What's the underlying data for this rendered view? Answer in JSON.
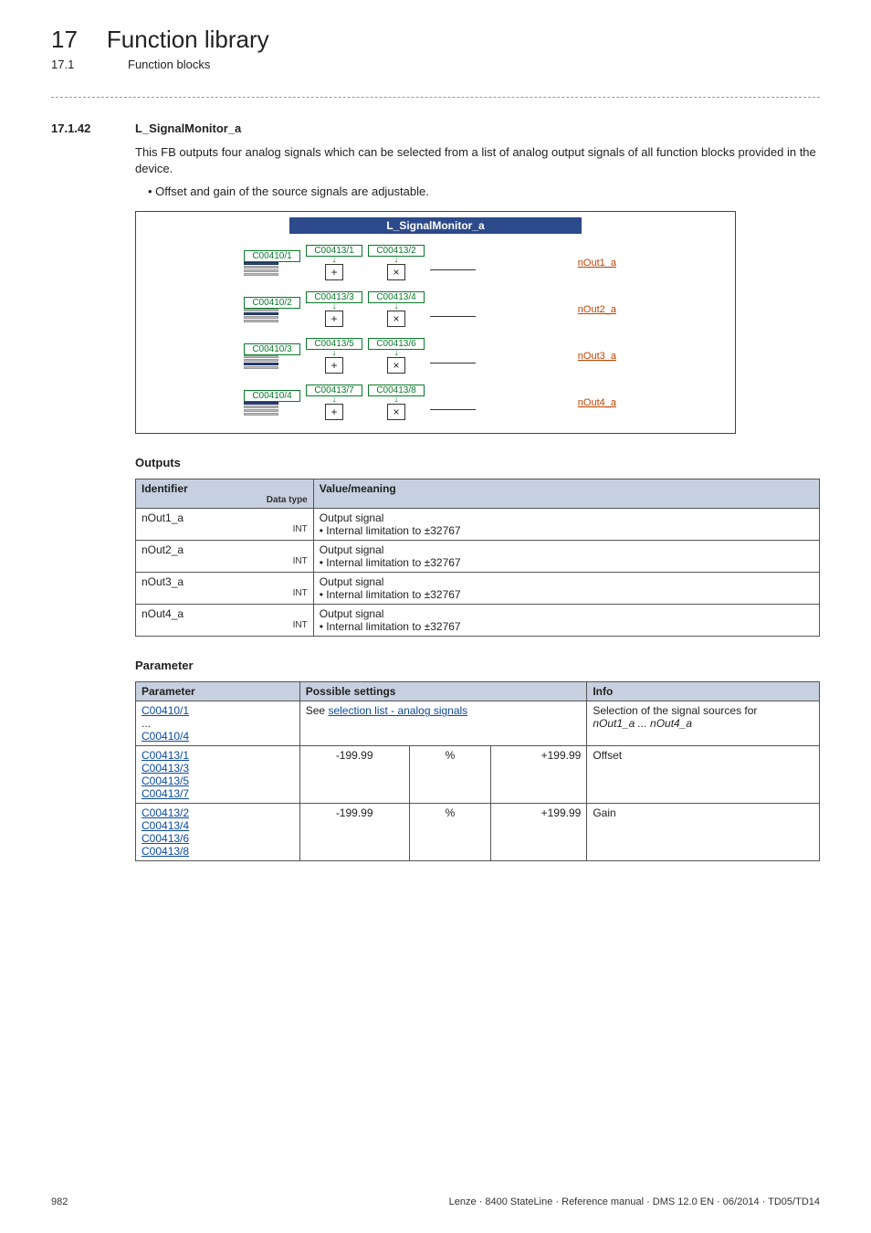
{
  "header": {
    "chapter_num": "17",
    "chapter_title": "Function library",
    "sub_num": "17.1",
    "sub_title": "Function blocks"
  },
  "section": {
    "num": "17.1.42",
    "title": "L_SignalMonitor_a",
    "lead": "This FB outputs four analog signals which can be selected from a list of analog output signals of all function blocks provided in the device.",
    "bullet1": "Offset and gain of the source signals are adjustable."
  },
  "diagram": {
    "title": "L_SignalMonitor_a",
    "rows": [
      {
        "c1": "C00410/1",
        "c2": "C00413/1",
        "c3": "C00413/2",
        "out": "nOut1_a"
      },
      {
        "c1": "C00410/2",
        "c2": "C00413/3",
        "c3": "C00413/4",
        "out": "nOut2_a"
      },
      {
        "c1": "C00410/3",
        "c2": "C00413/5",
        "c3": "C00413/6",
        "out": "nOut3_a"
      },
      {
        "c1": "C00410/4",
        "c2": "C00413/7",
        "c3": "C00413/8",
        "out": "nOut4_a"
      }
    ]
  },
  "outputs": {
    "heading": "Outputs",
    "head_id": "Identifier",
    "head_dt": "Data type",
    "head_val": "Value/meaning",
    "rows": [
      {
        "id": "nOut1_a",
        "dt": "INT",
        "l1": "Output signal",
        "l2": "• Internal limitation to ±32767"
      },
      {
        "id": "nOut2_a",
        "dt": "INT",
        "l1": "Output signal",
        "l2": "• Internal limitation to ±32767"
      },
      {
        "id": "nOut3_a",
        "dt": "INT",
        "l1": "Output signal",
        "l2": "• Internal limitation to ±32767"
      },
      {
        "id": "nOut4_a",
        "dt": "INT",
        "l1": "Output signal",
        "l2": "• Internal limitation to ±32767"
      }
    ]
  },
  "params": {
    "heading": "Parameter",
    "head_param": "Parameter",
    "head_poss": "Possible settings",
    "head_info": "Info",
    "row1": {
      "p1": "C00410/1",
      "dots": "...",
      "p2": "C00410/4",
      "see": "See ",
      "link": "selection list - analog signals",
      "info1": "Selection of the signal sources for",
      "info2": "nOut1_a ... nOut4_a"
    },
    "row2": {
      "p1": "C00413/1",
      "p2": "C00413/3",
      "p3": "C00413/5",
      "p4": "C00413/7",
      "lo": "-199.99",
      "unit": "%",
      "hi": "+199.99",
      "info": "Offset"
    },
    "row3": {
      "p1": "C00413/2",
      "p2": "C00413/4",
      "p3": "C00413/6",
      "p4": "C00413/8",
      "lo": "-199.99",
      "unit": "%",
      "hi": "+199.99",
      "info": "Gain"
    }
  },
  "footer": {
    "page": "982",
    "right": "Lenze · 8400 StateLine · Reference manual · DMS 12.0 EN · 06/2014 · TD05/TD14"
  }
}
